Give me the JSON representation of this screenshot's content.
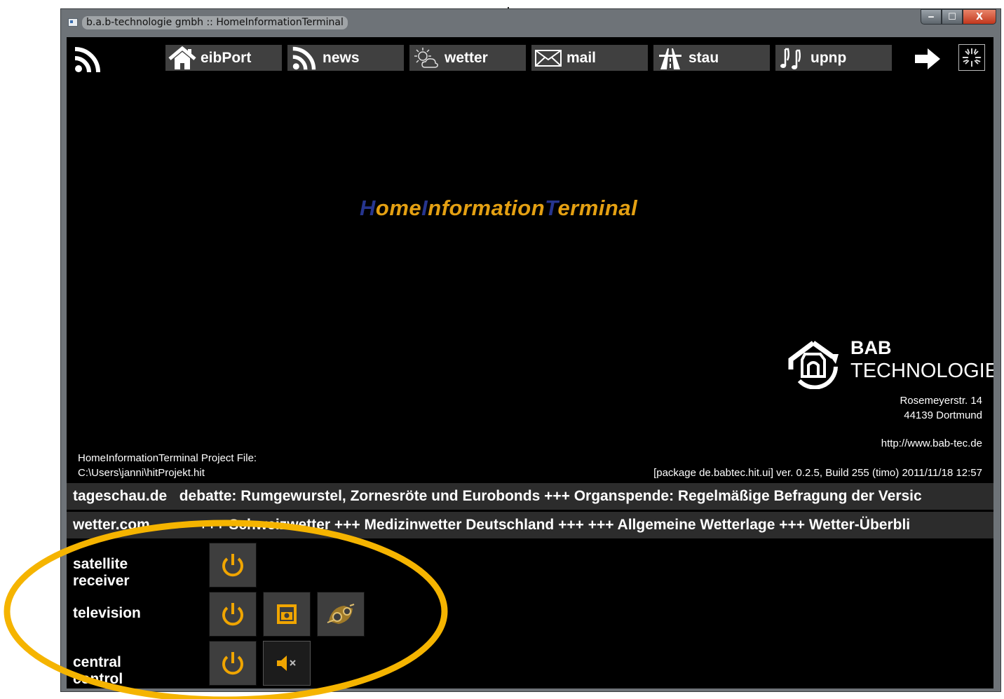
{
  "window": {
    "title": "b.a.b-technologie gmbh :: HomeInformationTerminal",
    "buttons": {
      "minimize": "‒",
      "maximize": "☐",
      "close": "X"
    }
  },
  "nav": {
    "items": [
      {
        "label": "eibPort",
        "icon": "home-icon"
      },
      {
        "label": "news",
        "icon": "rss-icon"
      },
      {
        "label": "wetter",
        "icon": "weather-icon"
      },
      {
        "label": "mail",
        "icon": "mail-icon"
      },
      {
        "label": "stau",
        "icon": "road-icon"
      },
      {
        "label": "upnp",
        "icon": "music-icon"
      }
    ],
    "next_icon": "arrow-right-icon",
    "loading_icon": "spinner-icon"
  },
  "logo": {
    "parts": [
      {
        "cap": "H",
        "rest": "ome"
      },
      {
        "cap": "I",
        "rest": "nformation"
      },
      {
        "cap": "T",
        "rest": "erminal"
      }
    ]
  },
  "company": {
    "name": "BAB",
    "subtitle": "TECHNOLOGIE",
    "street": "Rosemeyerstr. 14",
    "city": "44139 Dortmund",
    "url": "http://www.bab-tec.de"
  },
  "project": {
    "label": "HomeInformationTerminal Project File:",
    "path": "C:\\Users\\janni\\hitProjekt.hit"
  },
  "version": "[package de.babtec.hit.ui] ver. 0.2.5, Build 255 (timo) 2011/11/18 12:57",
  "tickers": [
    {
      "source": "tageschau.de",
      "text": "debatte: Rumgewurstel, Zornesröte und Eurobonds  +++  Organspende: Regelmäßige Befragung der Versic"
    },
    {
      "source": "wetter.com",
      "text": "+++  Schweizwetter  +++  Medizinwetter Deutschland  +++  +++  Allgemeine Wetterlage  +++  Wetter-Überbli"
    }
  ],
  "controls": [
    {
      "label": "satellite receiver",
      "buttons": [
        "power-icon"
      ]
    },
    {
      "label": "television",
      "buttons": [
        "power-icon",
        "source-icon",
        "film-icon"
      ]
    },
    {
      "label": "central control",
      "buttons": [
        "power-icon",
        "mute-icon"
      ]
    }
  ],
  "colors": {
    "background": "#000000",
    "accent_orange": "#e4a012",
    "accent_blue": "#26358f",
    "highlight_circle": "#f5b400",
    "nav_button": "#404040"
  }
}
